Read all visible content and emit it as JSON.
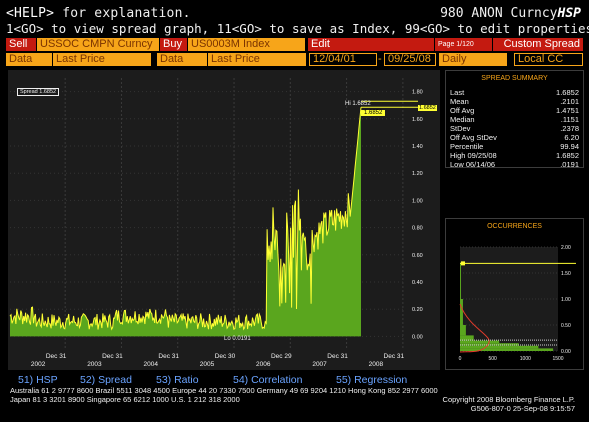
{
  "header": {
    "help_key": "<HELP>",
    "help_text": " for explanation.",
    "right_code": "980 ANON",
    "right_type": "Curncy",
    "right_func": "HSP",
    "instructions": "1<GO> to view spread graph, 11<GO> to save as Index, 99<GO> to edit properties"
  },
  "toolbar": {
    "sell_label": "Sell",
    "sell_ticker": "USSOC CMPN Curncy",
    "buy_label": "Buy",
    "buy_ticker": "US0003M Index",
    "edit_label": "Edit",
    "page_label": "Page 1/120",
    "custom_spread_label": "Custom Spread"
  },
  "row2": {
    "data1_label": "Data",
    "data1_value": "Last Price",
    "data2_label": "Data",
    "data2_value": "Last Price",
    "date_from": "12/04/01",
    "date_sep": "-",
    "date_to": "09/25/08",
    "period": "Daily",
    "currency": "Local CC"
  },
  "legend": {
    "series_label": "Spread",
    "series_value": "1.6852"
  },
  "chart_data": {
    "type": "area",
    "series": [
      {
        "name": "Spread",
        "last": 1.6852
      }
    ],
    "x_year_labels": [
      "2002",
      "2003",
      "2004",
      "2005",
      "2006",
      "2007",
      "2008"
    ],
    "x_month_labels": [
      "Dec 31",
      "Dec 31",
      "Dec 31",
      "Dec 30",
      "Dec 29",
      "Dec 31",
      "Dec 31"
    ],
    "y_ticks": [
      "1.80",
      "1.60",
      "1.40",
      "1.20",
      "1.00",
      "0.80",
      "0.60",
      "0.40",
      "0.20",
      "0.00"
    ],
    "ylim": [
      -0.1,
      1.9
    ],
    "high_label": "Hi 1.6852",
    "last_label": "1.6852",
    "lo_label": "Lo 0.0191",
    "line_color": "#ffff33",
    "fill_color": "#5aa61e"
  },
  "spread_summary": {
    "title": "SPREAD SUMMARY",
    "rows": [
      {
        "label": "Last",
        "value": "1.6852"
      },
      {
        "label": "Mean",
        "value": ".2101"
      },
      {
        "label": "Off Avg",
        "value": "1.4751"
      },
      {
        "label": "Median",
        "value": ".1151"
      },
      {
        "label": "StDev",
        "value": ".2378"
      },
      {
        "label": "Off Avg StDev",
        "value": "6.20"
      },
      {
        "label": "Percentile",
        "value": "99.94"
      },
      {
        "label": "High 09/25/08",
        "value": "1.6852"
      },
      {
        "label": "Low 06/14/06",
        "value": ".0191"
      }
    ]
  },
  "occurrences": {
    "title": "OCCURRENCES",
    "x_ticks": [
      "0",
      "500",
      "1000",
      "1500"
    ],
    "y_ticks": [
      "2.00",
      "1.50",
      "1.00",
      "0.50",
      "0.00"
    ]
  },
  "menu": {
    "items": [
      "51) HSP",
      "52) Spread",
      "53) Ratio",
      "54) Correlation",
      "55) Regression"
    ]
  },
  "footer": {
    "line1": "Australia 61 2 9777 8600 Brazil 5511 3048 4500 Europe 44 20 7330 7500 Germany 49 69 9204 1210 Hong Kong 852 2977 6000",
    "line2": "Japan 81 3 3201 8900          Singapore 65 6212 1000          U.S. 1 212 318 2000",
    "copyright": "Copyright 2008 Bloomberg Finance L.P.",
    "session": "G506-807-0 25-Sep-08  9:15:57"
  }
}
